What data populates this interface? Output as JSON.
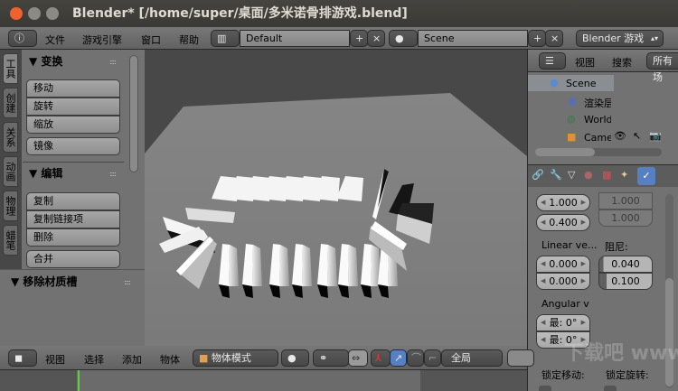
{
  "window": {
    "title": "Blender* [/home/super/桌面/多米诺骨排游戏.blend]",
    "close_color": "#f0622f"
  },
  "info_header": {
    "menus": [
      "文件",
      "游戏引擎",
      "窗口",
      "帮助"
    ],
    "layout": "Default",
    "scene": "Scene",
    "engine": "Blender 游戏"
  },
  "tool_tabs": [
    "工具",
    "创建",
    "关系",
    "动画",
    "物理",
    "蜡笔"
  ],
  "tool_panel": {
    "transform": {
      "title": "▼ 变换",
      "buttons": [
        "移动",
        "旋转",
        "缩放"
      ],
      "mirror": "镜像"
    },
    "edit": {
      "title": "▼ 编辑",
      "buttons": [
        "复制",
        "复制链接项",
        "删除"
      ],
      "join": "合并"
    },
    "remove_material_slot": "▼ 移除材质槽"
  },
  "outliner": {
    "menus": [
      "视图",
      "搜索"
    ],
    "filter": "所有场",
    "items": [
      {
        "label": "Scene",
        "icon": "scene-icon"
      },
      {
        "label": "渲染层",
        "icon": "render-layers-icon"
      },
      {
        "label": "World",
        "icon": "world-icon"
      },
      {
        "label": "Camera",
        "icon": "camera-icon"
      }
    ]
  },
  "properties": {
    "top_values": [
      "1.000",
      "0.400"
    ],
    "top_right_values": [
      "1.000",
      "1.000"
    ],
    "linear_label": "Linear ve...",
    "linear_values": [
      "0.000",
      "0.000"
    ],
    "damping_label": "阻尼:",
    "damping_values": [
      "0.040",
      "0.100"
    ],
    "damping_fill": [
      0.04,
      0.1
    ],
    "angular_label": "Angular v",
    "angular_values": [
      "最: 0°",
      "最: 0°"
    ],
    "lock_move": "锁定移动:",
    "lock_rotate": "锁定旋转:"
  },
  "view_header": {
    "menus": [
      "视图",
      "选择",
      "添加",
      "物体"
    ],
    "mode": "物体模式",
    "orientation": "全局"
  },
  "watermark": "下载吧 www.xiazaiba.com"
}
